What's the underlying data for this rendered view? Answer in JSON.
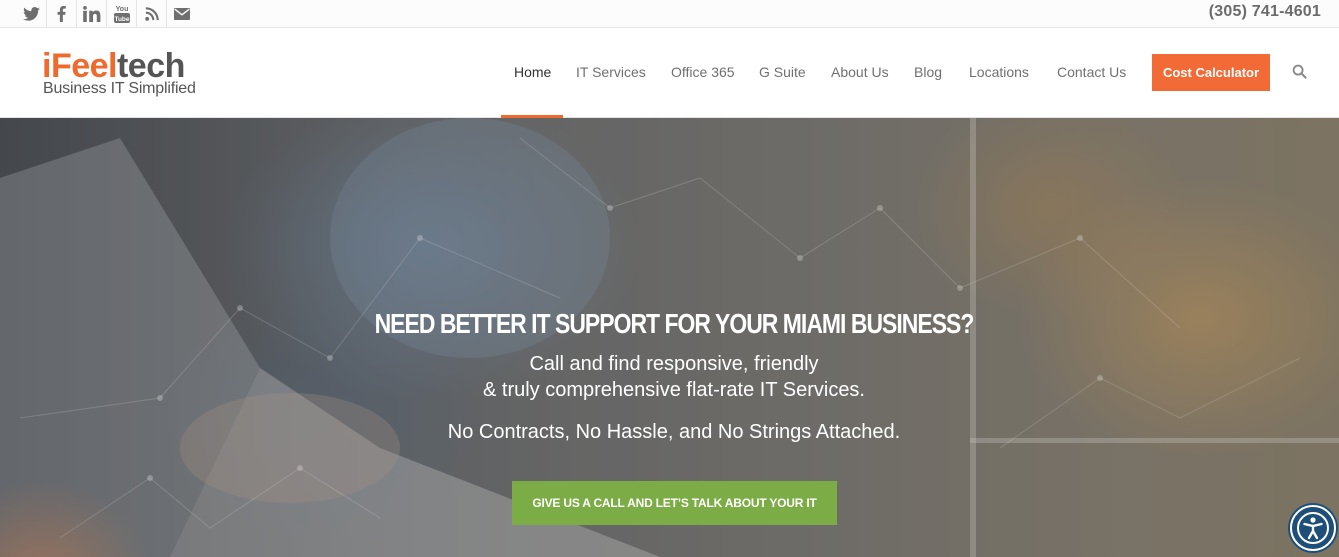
{
  "topbar": {
    "social_icons": [
      "twitter-icon",
      "facebook-icon",
      "linkedin-icon",
      "youtube-icon",
      "rss-icon",
      "mail-icon"
    ],
    "youtube_text_top": "You",
    "youtube_text_bottom": "Tube",
    "phone": "(305) 741-4601"
  },
  "header": {
    "logo": {
      "part1": "iFeel",
      "part2": "tech",
      "tagline": "Business IT Simplified"
    },
    "nav": [
      {
        "label": "Home",
        "active": true
      },
      {
        "label": "IT Services"
      },
      {
        "label": "Office 365"
      },
      {
        "label": "G Suite"
      },
      {
        "label": "About Us"
      },
      {
        "label": "Blog"
      },
      {
        "label": "Locations"
      },
      {
        "label": "Contact Us"
      }
    ],
    "cta_label": "Cost Calculator",
    "search_icon": "search-icon"
  },
  "hero": {
    "title": "NEED BETTER IT SUPPORT FOR YOUR MIAMI BUSINESS?",
    "line1": "Call and find responsive, friendly",
    "line2": "& truly comprehensive flat-rate IT Services.",
    "line3": "No Contracts, No Hassle, and No Strings Attached.",
    "button_label": "GIVE US A CALL AND LET’S TALK ABOUT YOUR IT"
  },
  "accessibility_icon": "accessibility-icon",
  "colors": {
    "brand_orange": "#f26a36",
    "cta_green": "#7cac45",
    "accessibility_blue": "#1d4f7a"
  }
}
